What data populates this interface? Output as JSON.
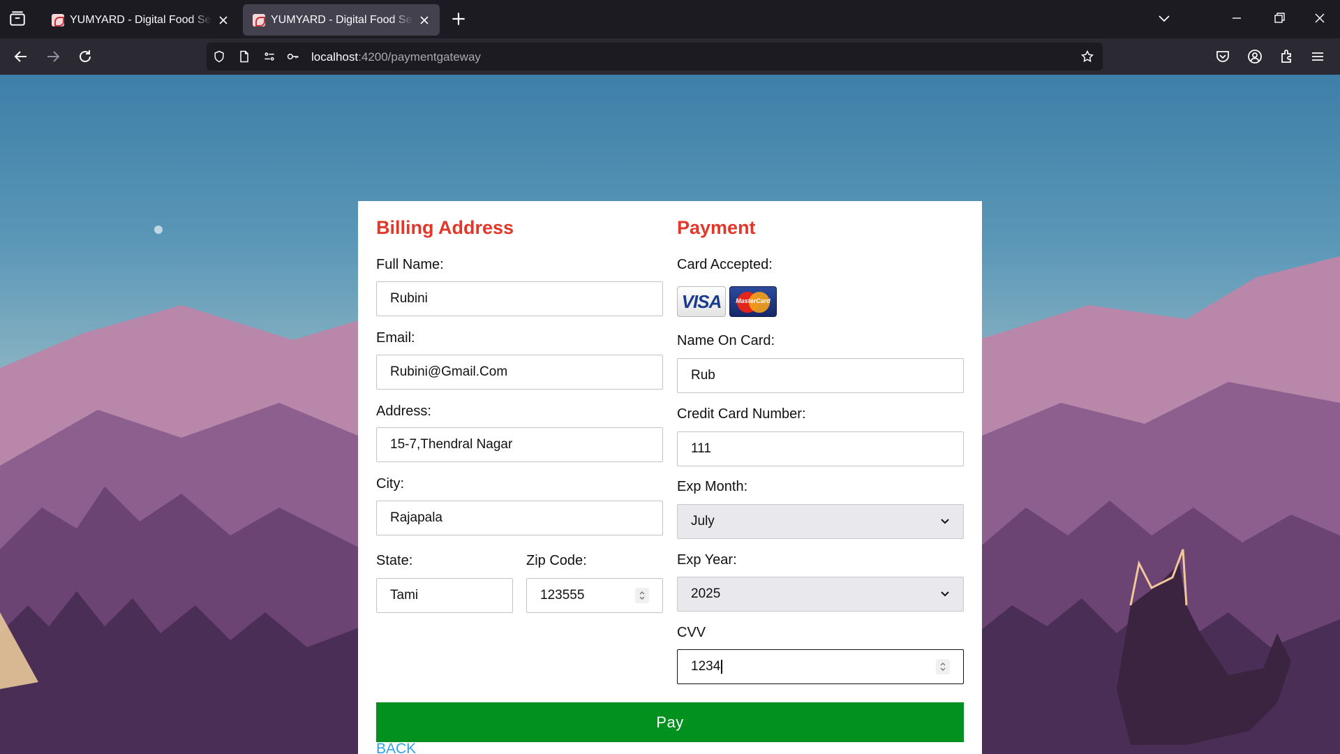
{
  "browser": {
    "tabs": [
      {
        "title": "YUMYARD - Digital Food Service",
        "active": false
      },
      {
        "title": "YUMYARD - Digital Food Service",
        "active": true
      }
    ],
    "url": {
      "host": "localhost",
      "path": ":4200/paymentgateway"
    }
  },
  "billing": {
    "title": "Billing Address",
    "full_name_label": "Full Name:",
    "full_name_value": "Rubini",
    "email_label": "Email:",
    "email_value": "Rubini@Gmail.Com",
    "address_label": "Address:",
    "address_value": "15-7,Thendral Nagar",
    "city_label": "City:",
    "city_value": "Rajapala",
    "state_label": "State:",
    "state_value": "Tami",
    "zip_label": "Zip Code:",
    "zip_value": "123555"
  },
  "payment": {
    "title": "Payment",
    "cards_label": "Card Accepted:",
    "card_brands": [
      "VISA",
      "MasterCard"
    ],
    "name_on_card_label": "Name On Card:",
    "name_on_card_value": "Rub",
    "card_number_label": "Credit Card Number:",
    "card_number_value": "111",
    "exp_month_label": "Exp Month:",
    "exp_month_value": "July",
    "exp_year_label": "Exp Year:",
    "exp_year_value": "2025",
    "cvv_label": "CVV",
    "cvv_value": "1234"
  },
  "actions": {
    "pay_label": "Pay",
    "back_label": "BACK"
  },
  "colors": {
    "heading": "#e2382a",
    "pay_button": "#02901f",
    "link": "#33a3e3"
  }
}
